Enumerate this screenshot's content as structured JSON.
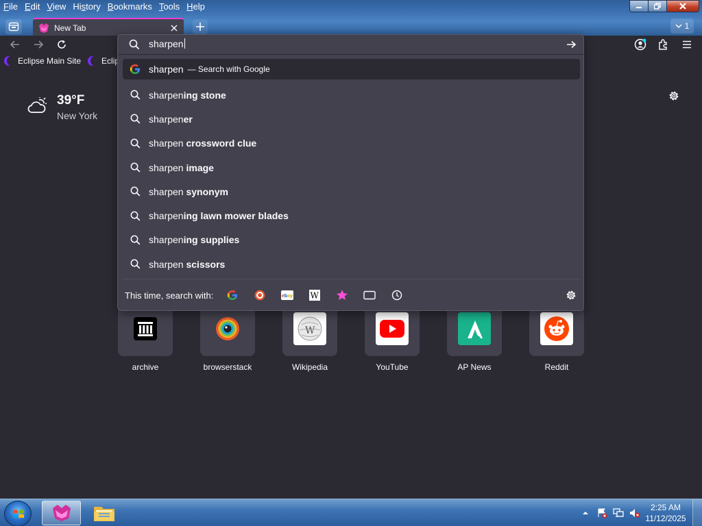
{
  "menu": {
    "items": [
      {
        "u": "F",
        "rest": "ile"
      },
      {
        "u": "E",
        "rest": "dit"
      },
      {
        "u": "V",
        "rest": "iew"
      },
      {
        "pre": "Hi",
        "u": "s",
        "rest": "tory"
      },
      {
        "u": "B",
        "rest": "ookmarks"
      },
      {
        "u": "T",
        "rest": "ools"
      },
      {
        "u": "H",
        "rest": "elp"
      }
    ]
  },
  "tabs": {
    "active_title": "New Tab",
    "tab_count": "1"
  },
  "bookmarks": [
    "Eclipse Main Site",
    "Eclips"
  ],
  "urlbar": {
    "query": "sharpen",
    "results": [
      {
        "typed": "sharpen",
        "suffix": "",
        "action": "— Search with Google",
        "icon": "google-icon"
      },
      {
        "typed": "sharpen",
        "suffix": "ing stone",
        "action": "",
        "icon": "search-icon"
      },
      {
        "typed": "sharpen",
        "suffix": "er",
        "action": "",
        "icon": "search-icon"
      },
      {
        "typed": "sharpen ",
        "suffix": "crossword clue",
        "action": "",
        "icon": "search-icon"
      },
      {
        "typed": "sharpen ",
        "suffix": "image",
        "action": "",
        "icon": "search-icon"
      },
      {
        "typed": "sharpen ",
        "suffix": "synonym",
        "action": "",
        "icon": "search-icon"
      },
      {
        "typed": "sharpen",
        "suffix": "ing lawn mower blades",
        "action": "",
        "icon": "search-icon"
      },
      {
        "typed": "sharpen",
        "suffix": "ing supplies",
        "action": "",
        "icon": "search-icon"
      },
      {
        "typed": "sharpen ",
        "suffix": "scissors",
        "action": "",
        "icon": "search-icon"
      }
    ],
    "oneoff_label": "This time, search with:",
    "engines": [
      "google-icon",
      "duckduckgo-icon",
      "ebay-icon",
      "wikipedia-icon",
      "bookmarks-star-icon",
      "tabs-icon",
      "history-icon"
    ]
  },
  "weather": {
    "temperature": "39°F",
    "city": "New York",
    "icon": "cloud-sun-icon"
  },
  "shortcuts": [
    {
      "label": "archive",
      "icon": "archive-icon"
    },
    {
      "label": "browserstack",
      "icon": "browserstack-icon"
    },
    {
      "label": "Wikipedia",
      "icon": "wikipedia-icon"
    },
    {
      "label": "YouTube",
      "icon": "youtube-icon"
    },
    {
      "label": "AP News",
      "icon": "apnews-icon"
    },
    {
      "label": "Reddit",
      "icon": "reddit-icon"
    }
  ],
  "taskbar": {
    "time": "2:25 AM",
    "date": "11/12/2025"
  },
  "colors": {
    "accent": "#ff3bd6",
    "background": "#2b2a33",
    "panel": "#42414d"
  }
}
